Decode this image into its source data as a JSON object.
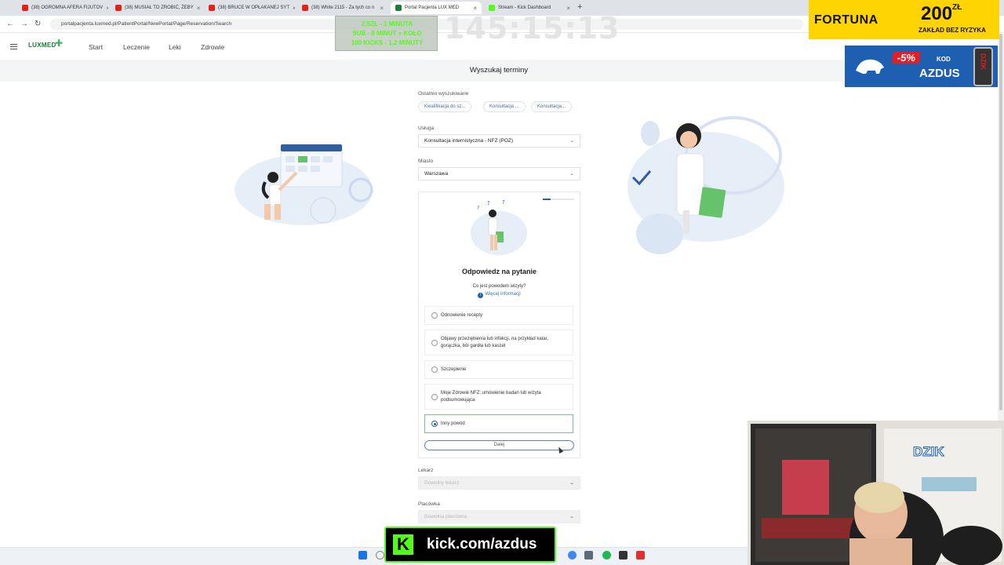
{
  "browser": {
    "tabs": [
      {
        "label": "(38) OGROMNA AFERA FIJUTOV",
        "favicon": "youtube-icon"
      },
      {
        "label": "(38) MUSIAŁ TO ZROBIĆ, ŻEBY",
        "favicon": "youtube-icon"
      },
      {
        "label": "(38) BRUCE W OPŁAKANEJ SYT",
        "favicon": "youtube-icon"
      },
      {
        "label": "(38) White 2115 - Za tych co n",
        "favicon": "youtube-icon"
      },
      {
        "label": "Portal Pacjenta LUX MED",
        "favicon": "luxmed-icon",
        "active": true
      },
      {
        "label": "Stream - Kick Dashboard",
        "favicon": "kick-icon"
      }
    ],
    "url": "portalpacjenta.luxmed.pl/PatientPortal/NewPortal/Page/Reservation/Search"
  },
  "site": {
    "logo": "LUXMED",
    "nav": [
      "Start",
      "Leczenie",
      "Leki",
      "Zdrowie"
    ],
    "page_title": "Wyszukaj terminy"
  },
  "form": {
    "recent_label": "Ostatnio wyszukiwane",
    "recent": [
      "Kwalifikacja do sz...",
      "Konsultacja ...",
      "Konsultacja..."
    ],
    "service_label": "Usługa",
    "service_value": "Konsultacja internistyczna - NFZ (POZ)",
    "city_label": "Miasto",
    "city_value": "Warszawa",
    "doctor_label": "Lekarz",
    "doctor_placeholder": "Dowolny lekarz",
    "clinic_label": "Placówka",
    "clinic_placeholder": "Dowolna placówka"
  },
  "question": {
    "progress": 0.25,
    "title": "Odpowiedz na pytanie",
    "subtitle": "Co jest powodem wizyty?",
    "more_info": "Więcej informacji",
    "options": [
      {
        "label": "Odnowienie recepty",
        "selected": false
      },
      {
        "label": "Objawy przeziębienia lub infekcji, na przykład katar, gorączka, ból gardła lub kaszel",
        "selected": false
      },
      {
        "label": "Szczepienie",
        "selected": false
      },
      {
        "label": "Moje Zdrowie NFZ: umówienie badań lub wizyta podsumowująca",
        "selected": false
      },
      {
        "label": "Inny powód",
        "selected": true
      }
    ],
    "next_button": "Dalej"
  },
  "overlays": {
    "badges": [
      "2,5ZŁ - 1 MINUTA",
      "SUB - 8 MINUT + KOŁO",
      "100 KICKS - 1,2 MINUTY"
    ],
    "timer": "145:15:13",
    "fortuna_brand": "FORTUNA",
    "fortuna_amount": "200",
    "fortuna_currency": "ZŁ",
    "fortuna_tag": "ZAKŁAD BEZ RYZYKA",
    "dzik_discount": "-5%",
    "dzik_kod": "KOD",
    "dzik_code": "AZDUS",
    "dzik_can_text": "DZIK",
    "webcam_logo": "DZIK",
    "kick_url": "kick.com/azdus"
  }
}
